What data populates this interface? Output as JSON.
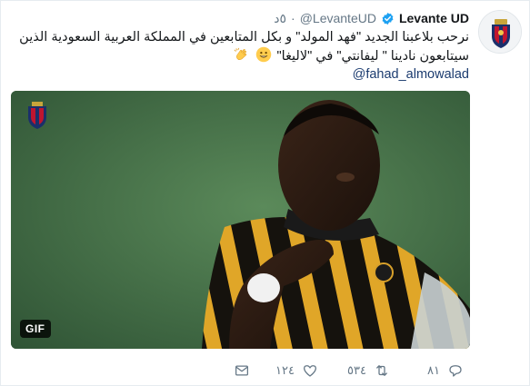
{
  "tweet": {
    "display_name": "Levante UD",
    "handle": "@LevanteUD",
    "time": "٥د",
    "text": "نرحب بلاعبنا الجديد \"فهد المولد\" و بكل المتابعين في المملكة العربية السعودية الذين سيتابعون نادينا \" ليفانتي\" في \"لاليغا\"",
    "mention": "@fahad_almowalad",
    "verified_color": "#1da1f2"
  },
  "media": {
    "badge": "GIF"
  },
  "actions": {
    "reply_count": "٨١",
    "retweet_count": "٥٣٤",
    "like_count": "١٢٤",
    "icon_color": "#657786"
  }
}
